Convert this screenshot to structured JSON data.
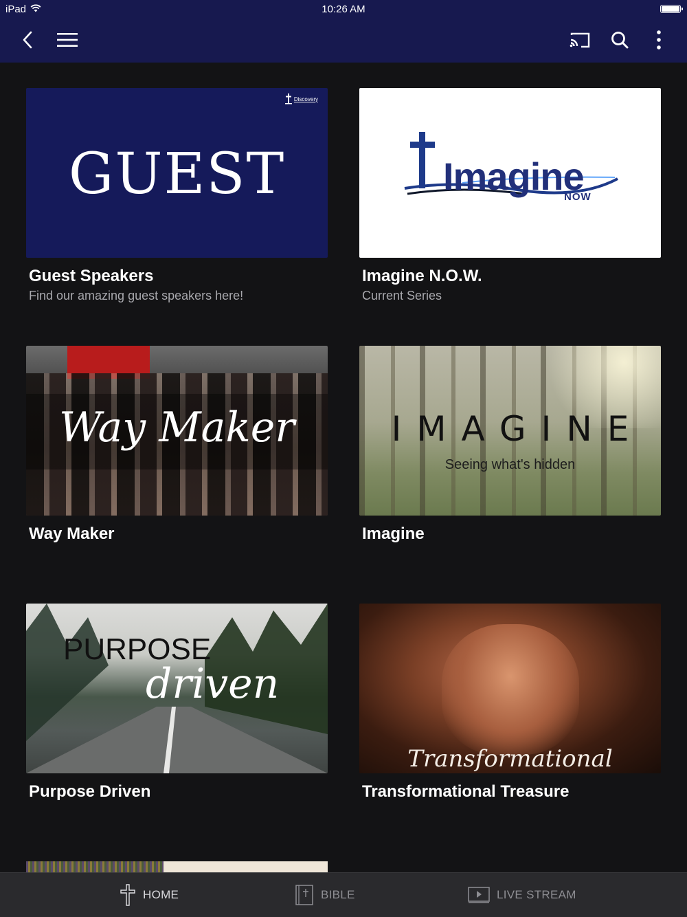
{
  "status_bar": {
    "device": "iPad",
    "time": "10:26 AM"
  },
  "nav": {
    "icons": [
      "back-chevron-icon",
      "hamburger-menu-icon",
      "cast-icon",
      "search-icon",
      "more-vertical-icon"
    ]
  },
  "cards": [
    {
      "title": "Guest Speakers",
      "subtitle": "Find our amazing guest speakers here!",
      "art_text": "GUEST",
      "badge_text": "Discovery"
    },
    {
      "title": "Imagine N.O.W.",
      "subtitle": "Current Series",
      "art_text": "Imagine",
      "art_subtext": "NOW"
    },
    {
      "title": "Way Maker",
      "art_text": "Way Maker"
    },
    {
      "title": "Imagine",
      "art_text": "IMAGINE",
      "art_subtext": "Seeing what's hidden"
    },
    {
      "title": "Purpose Driven",
      "art_text": "PURPOSE",
      "art_subtext": "driven"
    },
    {
      "title": "Transformational Treasure",
      "art_text": "Transformational Treasure"
    }
  ],
  "tabs": [
    {
      "label": "HOME",
      "icon": "cross-icon",
      "active": true
    },
    {
      "label": "BIBLE",
      "icon": "bible-book-icon",
      "active": false
    },
    {
      "label": "LIVE STREAM",
      "icon": "play-screen-icon",
      "active": false
    }
  ],
  "colors": {
    "nav_bg": "#17194f",
    "page_bg": "#131315",
    "tabbar_bg": "#2a2a2d",
    "guest_bg": "#151a5a"
  }
}
